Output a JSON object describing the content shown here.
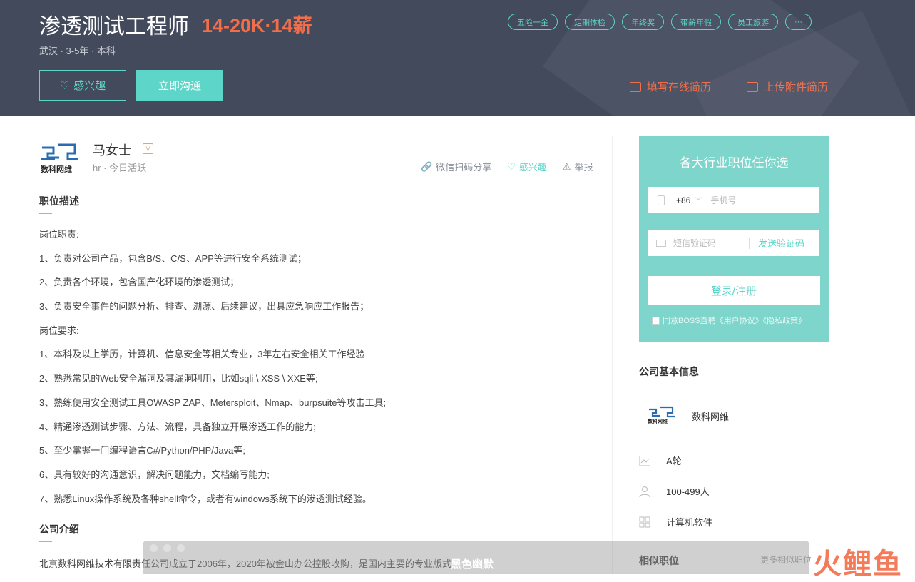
{
  "header": {
    "job_title": "渗透测试工程师",
    "salary": "14-20K·14薪",
    "meta": "武汉 · 3-5年 · 本科",
    "interest_btn": "感兴趣",
    "chat_btn": "立即沟通",
    "tags": [
      "五险一金",
      "定期体检",
      "年终奖",
      "带薪年假",
      "员工旅游",
      "···"
    ],
    "fill_resume": "填写在线简历",
    "upload_resume": "上传附件简历"
  },
  "recruiter": {
    "logo_text": "数科网维",
    "name": "马女士",
    "badge": "V",
    "meta": "hr · 今日活跃",
    "share": "微信扫码分享",
    "interest": "感兴趣",
    "report": "举报"
  },
  "job_description": {
    "title": "职位描述",
    "lines": [
      "岗位职责:",
      "1、负责对公司产品，包含B/S、C/S、APP等进行安全系统测试；",
      "2、负责各个环境，包含国产化环境的渗透测试；",
      "3、负责安全事件的问题分析、排查、溯源、后续建议，出具应急响应工作报告；",
      "岗位要求:",
      "1、本科及以上学历，计算机、信息安全等相关专业，3年左右安全相关工作经验",
      "2、熟悉常见的Web安全漏洞及其漏洞利用，比如sqli \\ XSS \\ XXE等;",
      "3、熟练使用安全测试工具OWASP ZAP、Metersploit、Nmap、burpsuite等攻击工具;",
      "4、精通渗透测试步骤、方法、流程，具备独立开展渗透工作的能力;",
      "5、至少掌握一门编程语言C#/Python/PHP/Java等;",
      "6、具有较好的沟通意识，解决问题能力，文档编写能力;",
      "7、熟悉Linux操作系统及各种shell命令，或者有windows系统下的渗透测试经验。"
    ]
  },
  "company_intro": {
    "title": "公司介绍",
    "text": "北京数科网维技术有限责任公司成立于2006年，2020年被金山办公控股收购，是国内主要的专业版式"
  },
  "login_panel": {
    "title": "各大行业职位任你选",
    "prefix": "+86",
    "phone_placeholder": "手机号",
    "sms_placeholder": "短信验证码",
    "send_code": "发送验证码",
    "login_btn": "登录/注册",
    "agree": "同意BOSS直聘《用户协议》《隐私政策》"
  },
  "company_info": {
    "title": "公司基本信息",
    "name": "数科网维",
    "logo_text": "数科网维",
    "stage": "A轮",
    "size": "100-499人",
    "industry": "计算机软件"
  },
  "similar": {
    "title": "相似职位",
    "more": "更多相似职位"
  },
  "overlay": {
    "text": "黑色幽默",
    "watermark": "火鲤鱼"
  },
  "colors": {
    "header_bg": "#434a5c",
    "accent": "#5dd5c8",
    "salary": "#f26d49",
    "panel": "#7dd5cb"
  }
}
